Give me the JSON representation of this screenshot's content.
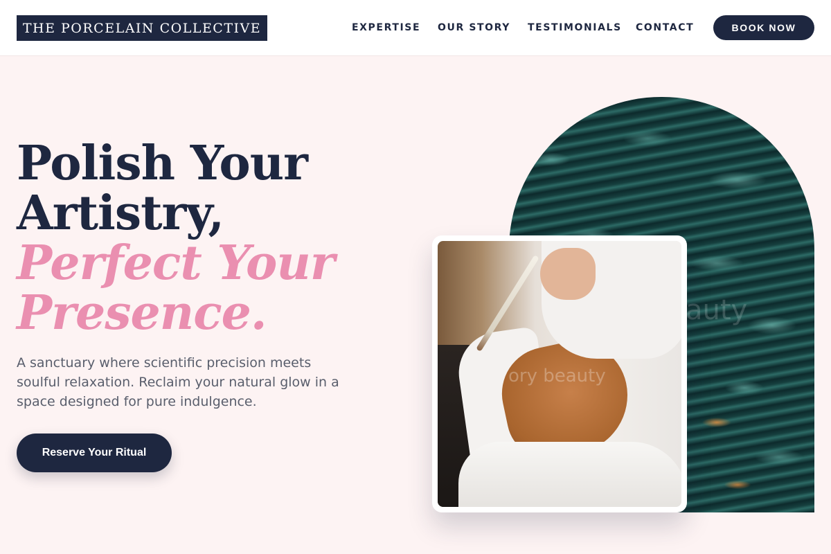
{
  "header": {
    "logo": "THE PORCELAIN COLLECTIVE",
    "nav": [
      "EXPERTISE",
      "OUR STORY",
      "TESTIMONIALS",
      "CONTACT"
    ],
    "book_label": "BOOK NOW"
  },
  "hero": {
    "headline_line1": "Polish Your",
    "headline_line2": "Artistry,",
    "headline_accent1": "Perfect Your",
    "headline_accent2": "Presence.",
    "subtext": "A sanctuary where scientific precision meets soulful relaxation. Reclaim your natural glow in a space designed for pure indulgence.",
    "cta_label": "Reserve Your Ritual"
  },
  "images": {
    "arch_watermark": "auty",
    "photo_watermark": "ory beauty"
  },
  "colors": {
    "navy": "#1e2740",
    "pink_accent": "#ea8fb0",
    "background": "#fdf3f3"
  }
}
